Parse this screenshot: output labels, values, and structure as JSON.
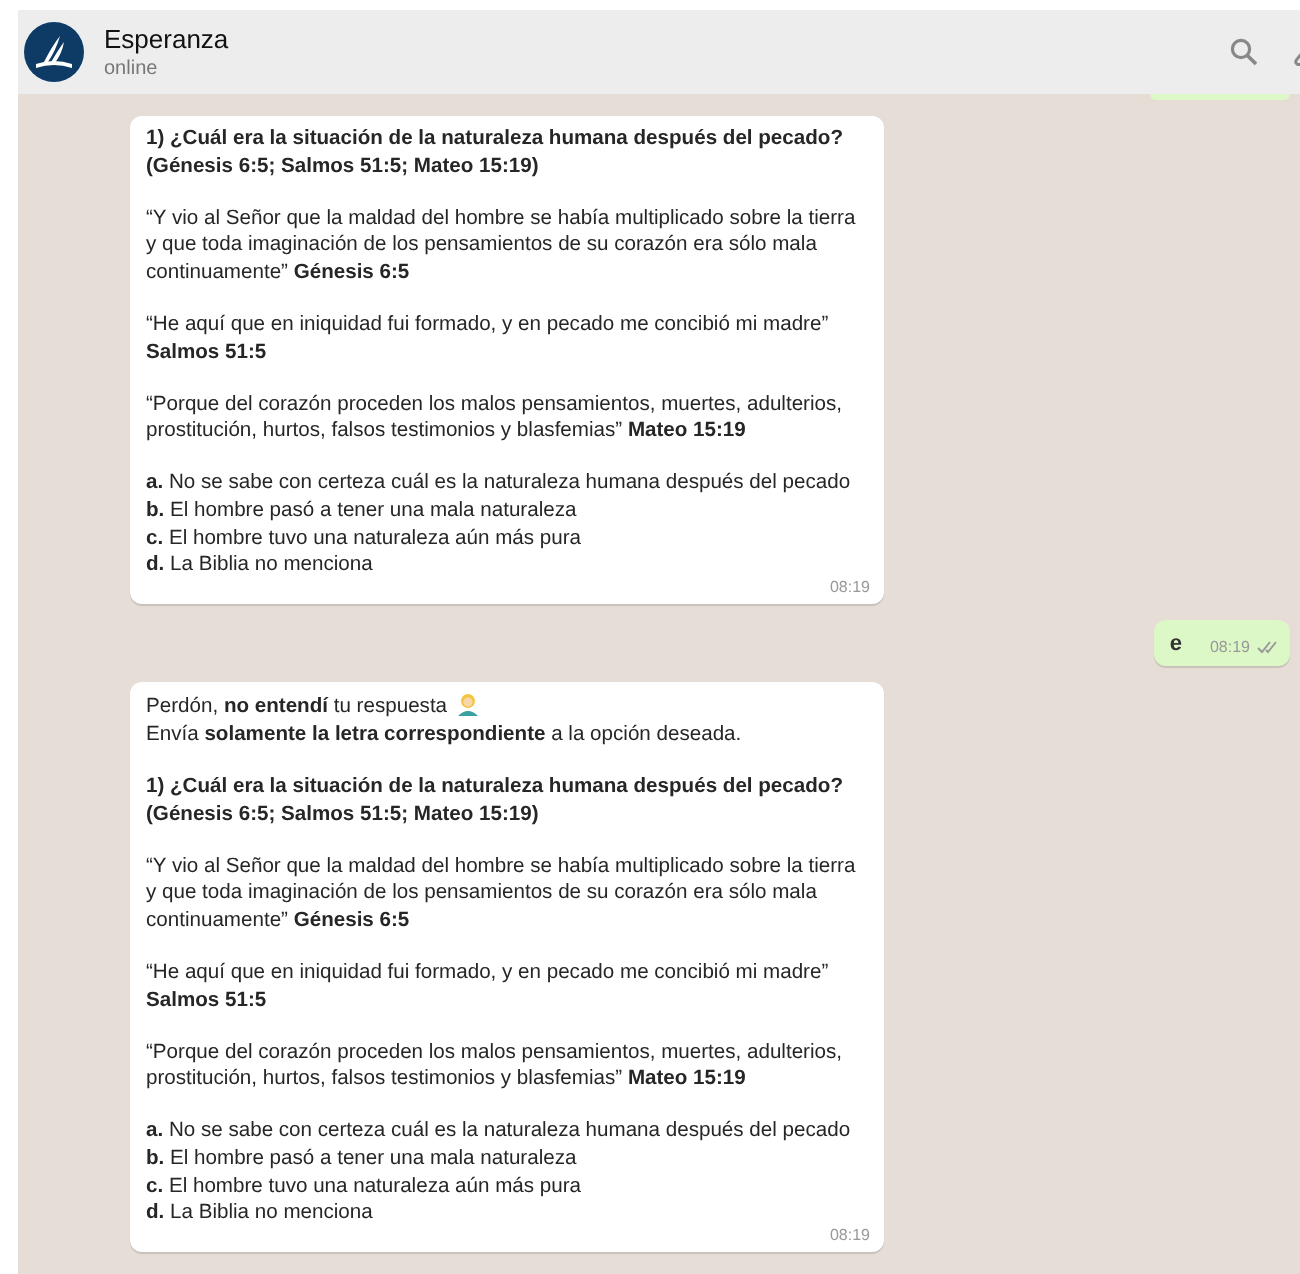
{
  "header": {
    "name": "Esperanza",
    "status": "online"
  },
  "messages": [
    {
      "kind": "outgoing_cut"
    },
    {
      "kind": "incoming",
      "blocks": [
        {
          "lines": [
            {
              "text": "**1) ¿Cuál era la situación de la naturaleza humana después del pecado? (Génesis 6:5; Salmos 51:5; Mateo 15:19)**"
            }
          ]
        },
        {
          "lines": [
            {
              "text": "“Y vio al Señor que la maldad del hombre se había multiplicado sobre la tierra y que toda imaginación de los pensamientos de su corazón era sólo mala continuamente” **Génesis 6:5**"
            }
          ]
        },
        {
          "lines": [
            {
              "text": "“He aquí que en iniquidad fui formado, y en pecado me concibió mi madre” **Salmos 51:5**"
            }
          ]
        },
        {
          "lines": [
            {
              "text": "“Porque del corazón proceden los malos pensamientos, muertes, adulterios, prostitución, hurtos, falsos testimonios y blasfemias” **Mateo 15:19**"
            }
          ]
        },
        {
          "lines": [
            {
              "text": "**a.** No se sabe con certeza cuál es la naturaleza humana después del pecado"
            },
            {
              "text": "**b.** El hombre pasó a tener una mala naturaleza"
            },
            {
              "text": "**c.** El hombre tuvo una naturaleza aún más pura"
            },
            {
              "text": "**d.** La Biblia no menciona"
            }
          ]
        }
      ],
      "time": "08:19"
    },
    {
      "kind": "outgoing",
      "text": "e",
      "time": "08:19",
      "read": false
    },
    {
      "kind": "incoming",
      "blocks": [
        {
          "lines": [
            {
              "text": "Perdón, **no entendí** tu respuesta",
              "emoji": true
            },
            {
              "text": "Envía **solamente la letra correspondiente** a la opción deseada."
            }
          ]
        },
        {
          "lines": [
            {
              "text": "**1) ¿Cuál era la situación de la naturaleza humana después del pecado? (Génesis 6:5; Salmos 51:5; Mateo 15:19)**"
            }
          ]
        },
        {
          "lines": [
            {
              "text": "“Y vio al Señor que la maldad del hombre se había multiplicado sobre la tierra y que toda imaginación de los pensamientos de su corazón era sólo mala continuamente” **Génesis 6:5**"
            }
          ]
        },
        {
          "lines": [
            {
              "text": "“He aquí que en iniquidad fui formado, y en pecado me concibió mi madre” **Salmos 51:5**"
            }
          ]
        },
        {
          "lines": [
            {
              "text": "“Porque del corazón proceden los malos pensamientos, muertes, adulterios, prostitución, hurtos, falsos testimonios y blasfemias” **Mateo 15:19**"
            }
          ]
        },
        {
          "lines": [
            {
              "text": "**a.** No se sabe con certeza cuál es la naturaleza humana después del pecado"
            },
            {
              "text": "**b.** El hombre pasó a tener una mala naturaleza"
            },
            {
              "text": "**c.** El hombre tuvo una naturaleza aún más pura"
            },
            {
              "text": "**d.** La Biblia no menciona"
            }
          ]
        }
      ],
      "time": "08:19"
    }
  ]
}
